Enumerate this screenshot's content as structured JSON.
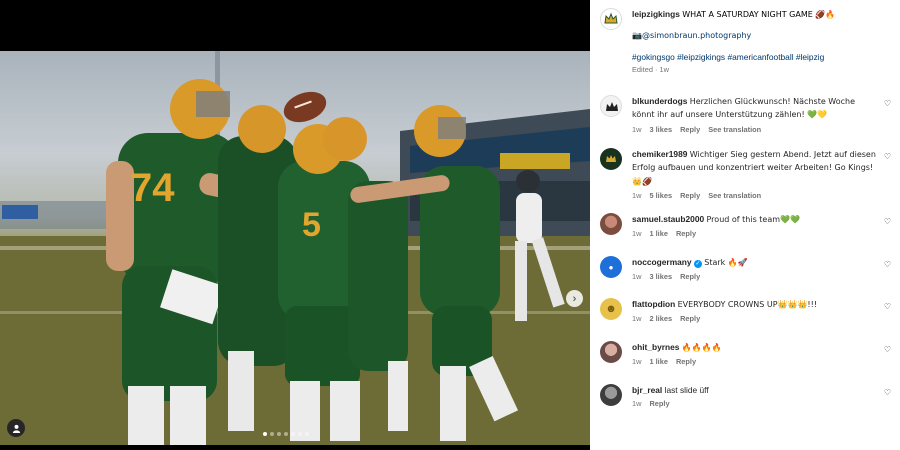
{
  "post": {
    "author": "leipzigkings",
    "caption": "WHAT A SATURDAY NIGHT GAME 🏈🔥",
    "photo_credit": "📷@simonbraun.photography",
    "hashtags": "#gokingsgo #leipzigkings #americanfootball #leipzig",
    "edited": "Edited · 1w"
  },
  "media": {
    "jersey_74": "74",
    "jersey_5": "5",
    "carousel_total": 7,
    "carousel_active": 0
  },
  "comments": [
    {
      "user": "blkunderdogs",
      "text": "Herzlichen Glückwunsch! Nächste Woche könnt ihr auf unsere Unterstützung zählen! 💚💛",
      "time": "1w",
      "likes": "3 likes",
      "reply": "Reply",
      "translate": "See translation"
    },
    {
      "user": "chemiker1989",
      "text": "Wichtiger Sieg gestern Abend. Jetzt auf diesen Erfolg aufbauen und konzentriert weiter Arbeiten! Go Kings! 👑🏈",
      "time": "1w",
      "likes": "5 likes",
      "reply": "Reply",
      "translate": "See translation"
    },
    {
      "user": "samuel.staub2000",
      "text": "Proud of this team💚💚",
      "time": "1w",
      "likes": "1 like",
      "reply": "Reply"
    },
    {
      "user": "noccogermany",
      "text": "Stark 🔥🚀",
      "time": "1w",
      "likes": "3 likes",
      "reply": "Reply"
    },
    {
      "user": "flattopdion",
      "text": "EVERYBODY CROWNS UP👑👑👑!!!",
      "time": "1w",
      "likes": "2 likes",
      "reply": "Reply"
    },
    {
      "user": "ohit_byrnes",
      "text": "🔥🔥🔥🔥",
      "time": "1w",
      "likes": "1 like",
      "reply": "Reply"
    },
    {
      "user": "bjr_real",
      "text": "last slide üff",
      "time": "1w",
      "reply": "Reply"
    }
  ],
  "colors": {
    "jersey_green": "#1f5a2b",
    "helmet_gold": "#d99a2a",
    "link_blue": "#00376b",
    "verified_blue": "#0095f6"
  },
  "icons": [
    "next-arrow-icon",
    "user-tag-icon",
    "heart-icon",
    "verified-badge-icon"
  ]
}
